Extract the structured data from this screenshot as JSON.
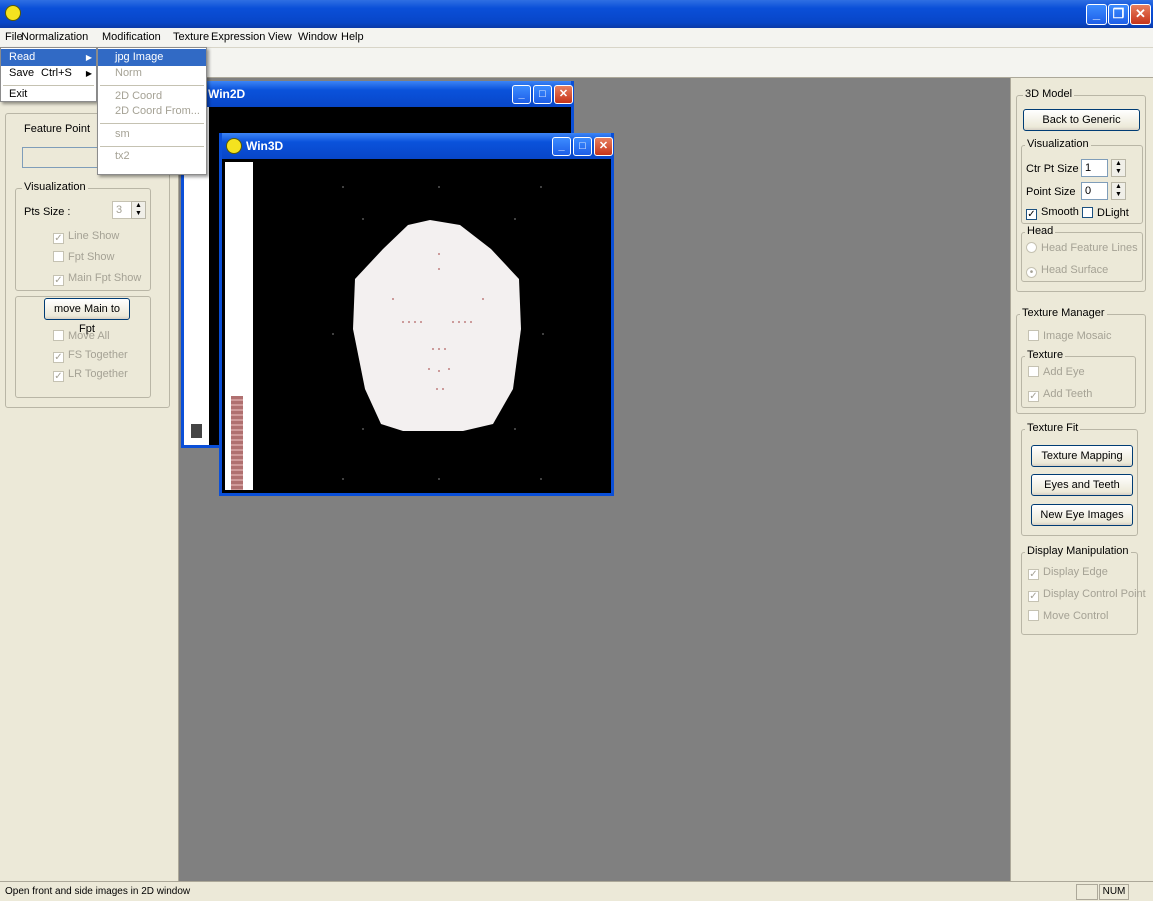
{
  "menubar": {
    "items": [
      "File",
      "Normalization",
      "Modification",
      "Texture",
      "Expression",
      "View",
      "Window",
      "Help"
    ]
  },
  "file_menu": {
    "read": "Read",
    "save": "Save",
    "save_shortcut": "Ctrl+S",
    "exit": "Exit"
  },
  "read_submenu": {
    "items": [
      "jpg Image",
      "Norm",
      "2D Coord",
      "2D Coord From...",
      "sm",
      "tx2"
    ]
  },
  "left_panel": {
    "feature_point_label": "Feature Point",
    "visualization": {
      "title": "Visualization",
      "pts_size_label": "Pts Size :",
      "pts_size_value": "3",
      "line_show": "Line Show",
      "fpt_show": "Fpt Show",
      "main_fpt_show": "Main Fpt Show"
    },
    "move_main_button": "move Main to Fpt",
    "move_all": "Move All",
    "fs_together": "FS Together",
    "lr_together": "LR Together"
  },
  "windows": {
    "win2d_title": "Win2D",
    "win3d_title": "Win3D"
  },
  "right_panel": {
    "model_3d": {
      "title": "3D Model",
      "back_button": "Back to Generic",
      "visualization_title": "Visualization",
      "ctr_pt_size_label": "Ctr Pt Size",
      "ctr_pt_size_value": "1",
      "point_size_label": "Point Size",
      "point_size_value": "0",
      "smooth": "Smooth",
      "dlight": "DLight",
      "head_title": "Head",
      "head_feature_lines": "Head Feature Lines",
      "head_surface": "Head Surface"
    },
    "texture_manager": {
      "title": "Texture Manager",
      "image_mosaic": "Image Mosaic",
      "texture_title": "Texture",
      "add_eye": "Add Eye",
      "add_teeth": "Add Teeth"
    },
    "texture_fit": {
      "title": "Texture Fit",
      "texture_mapping": "Texture Mapping",
      "eyes_and_teeth": "Eyes and Teeth",
      "new_eye_images": "New Eye Images"
    },
    "display_manipulation": {
      "title": "Display Manipulation",
      "display_edge": "Display Edge",
      "display_control_point": "Display Control Point",
      "move_control": "Move Control"
    }
  },
  "statusbar": {
    "message": "Open front and side images in 2D window",
    "num": "NUM"
  }
}
